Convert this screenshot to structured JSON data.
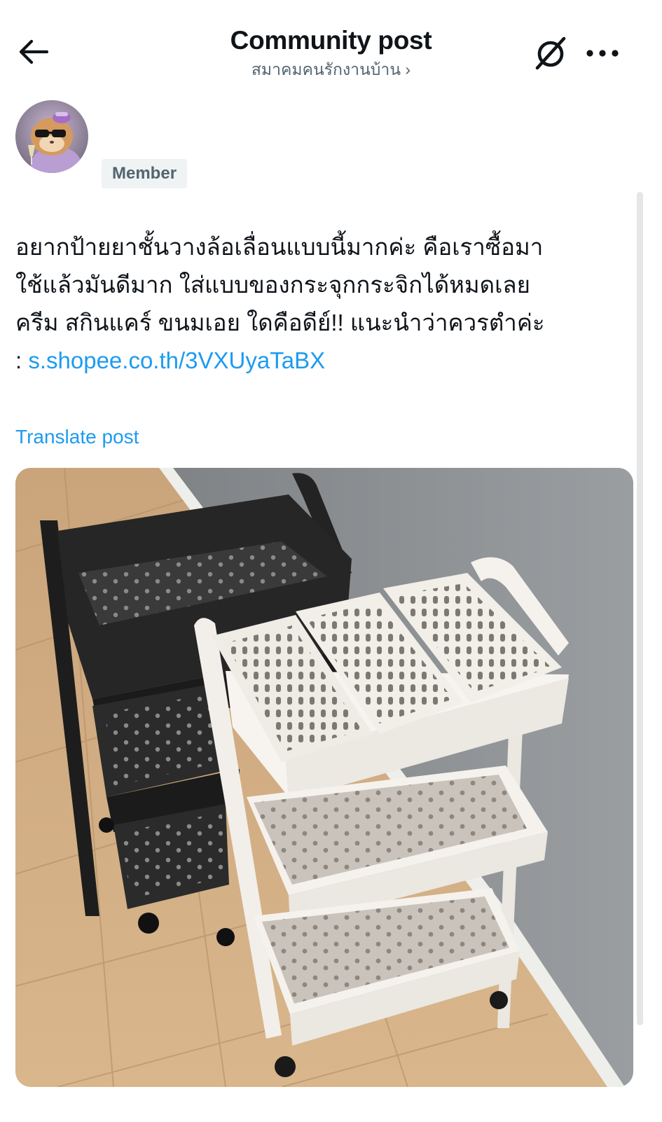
{
  "header": {
    "title": "Community post",
    "community_name": "สมาคมคนรักงานบ้าน ›"
  },
  "author": {
    "role_badge": "Member"
  },
  "post": {
    "lines": [
      "อยากป้ายยาชั้นวางล้อเลื่อนแบบนี้มากค่ะ คือเราซื้อมา",
      "ใช้แล้วมันดีมาก ใส่แบบของกระจุกกระจิกได้หมดเลย",
      "ครีม สกินแคร์ ขนมเอย ใดคือดีย์!! แนะนำว่าควรตำค่ะ"
    ],
    "link_prefix": ": ",
    "link_text": "s.shopee.co.th/3VXUyaTaBX"
  },
  "translate_label": "Translate post",
  "colors": {
    "link": "#1d9bf0",
    "secondary_text": "#536471",
    "badge_bg": "#eff3f4"
  },
  "icons": {
    "back": "arrow-left-icon",
    "grok": "grok-icon",
    "more": "more-horizontal-icon"
  }
}
